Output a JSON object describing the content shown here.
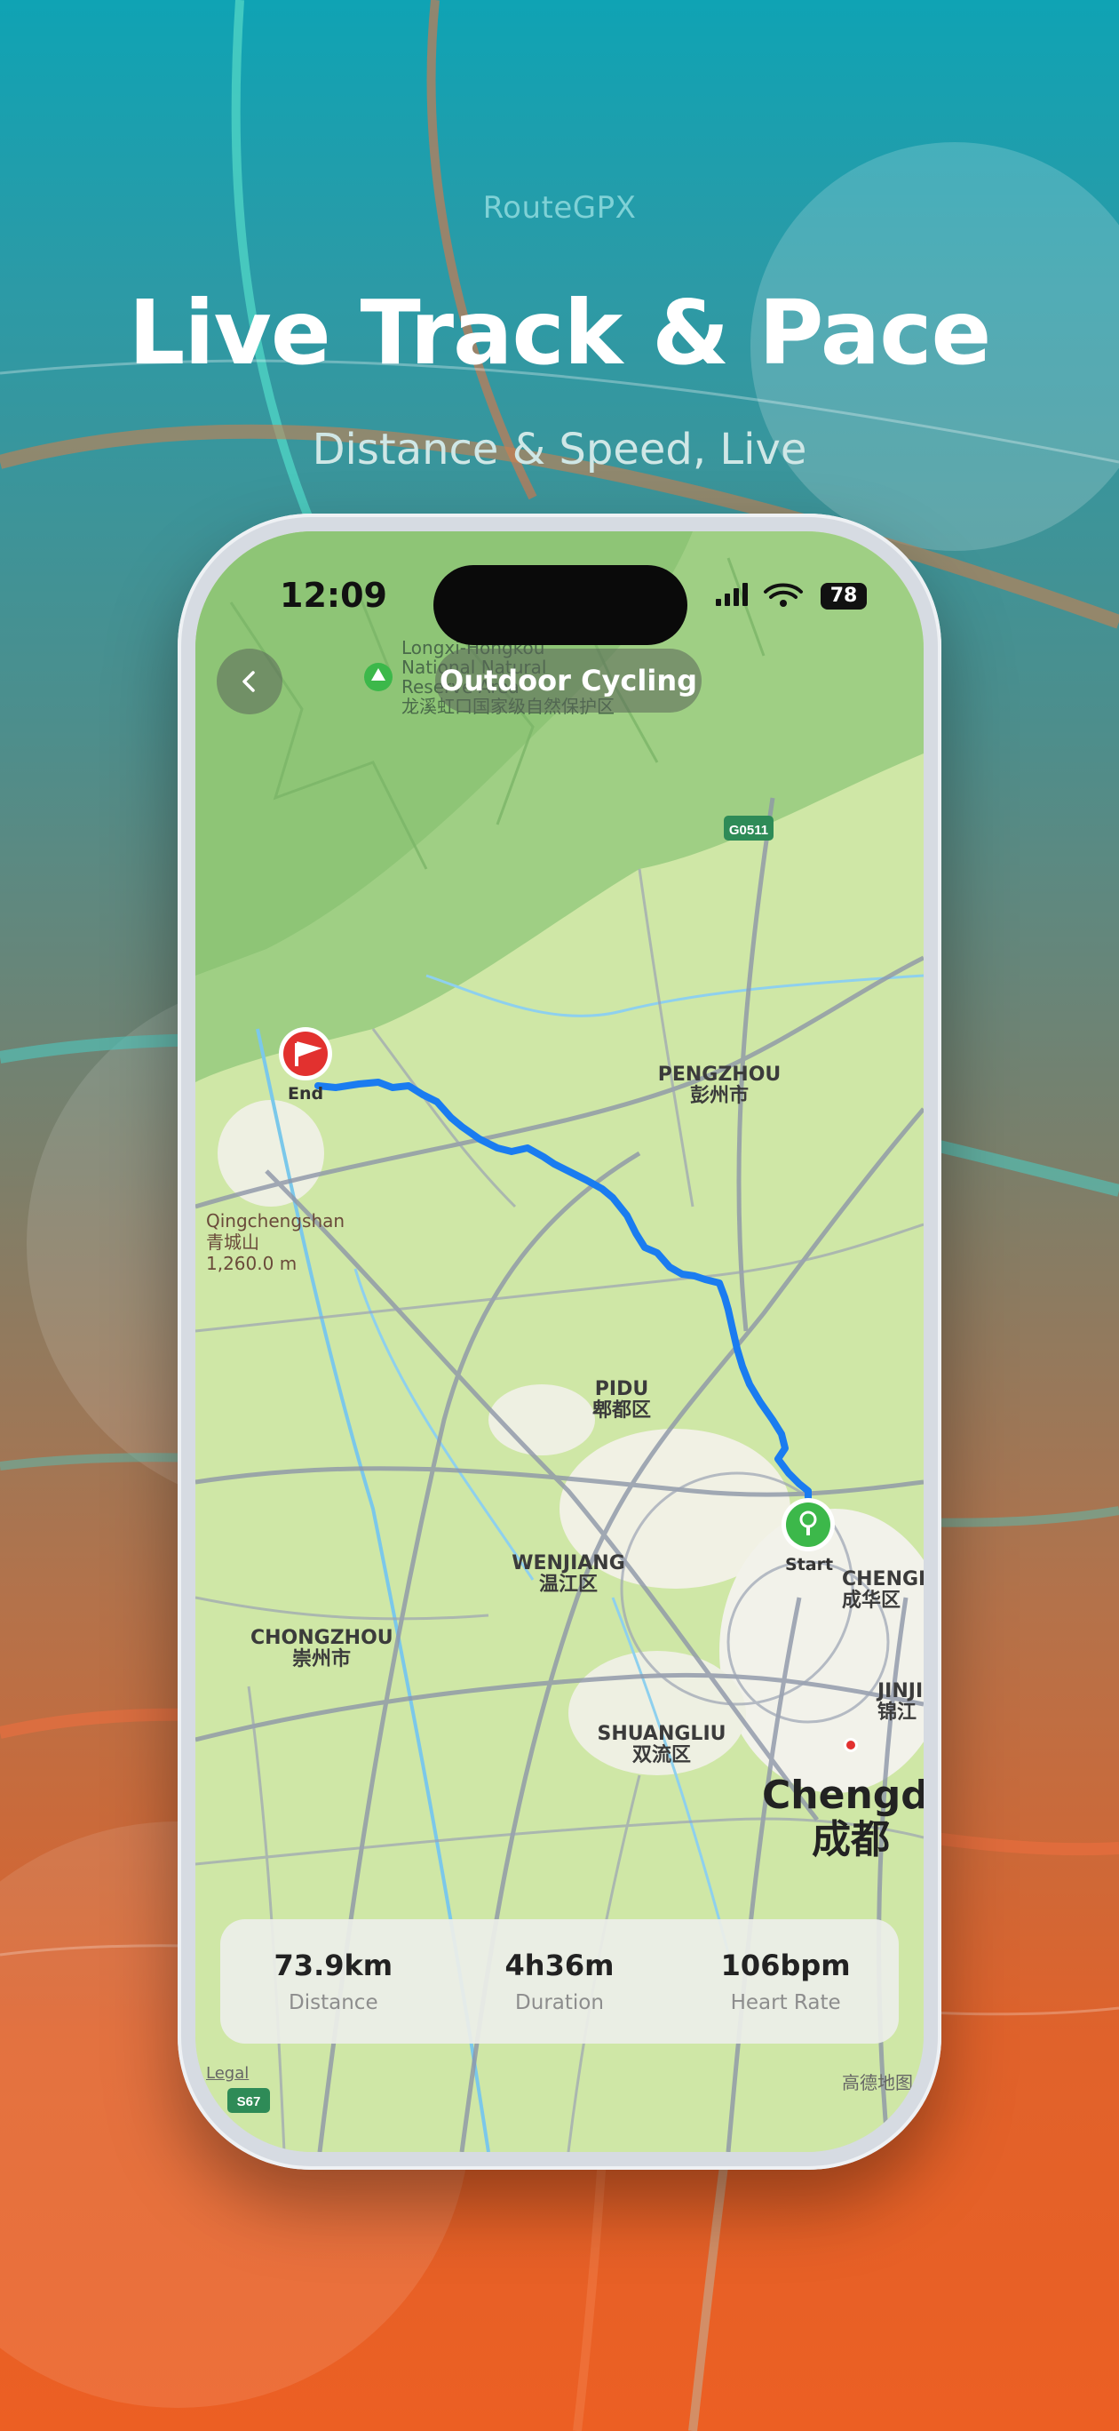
{
  "brand": "RouteGPX",
  "headline": "Live Track & Pace",
  "subline": "Distance & Speed, Live",
  "status_bar": {
    "time": "12:09",
    "battery": "78"
  },
  "header": {
    "title": "Outdoor Cycling"
  },
  "map": {
    "labels": {
      "reserve": "Longxi-Hongkou\nNational Natural\nReserve Area\n龙溪虹口国家级自然保护区",
      "pengzhou": "PENGZHOU\n彭州市",
      "qingcheng": "Qingchengshan\n青城山\n1,260.0 m",
      "pidu": "PIDU\n郫都区",
      "wenjiang": "WENJIANG\n温江区",
      "chongzhou": "CHONGZHOU\n崇州市",
      "chenghua": "CHENGH\n成华区",
      "jinjiang": "JINJI\n锦江",
      "shuangliu": "SHUANGLIU\n双流区",
      "chengdu": "Chengdu\n成都",
      "legal": "Legal",
      "attribution": "高德地图",
      "highway_g0511": "G0511",
      "highway_s67": "S67"
    },
    "end_label": "End",
    "start_label": "Start"
  },
  "stats": [
    {
      "value": "73.9km",
      "label": "Distance"
    },
    {
      "value": "4h36m",
      "label": "Duration"
    },
    {
      "value": "106bpm",
      "label": "Heart Rate"
    }
  ],
  "colors": {
    "route": "#1a7cf0",
    "start_marker": "#3cb84a",
    "end_marker": "#e2312f",
    "bg_top": "#0fa3b4",
    "bg_bottom": "#ec5f23"
  }
}
